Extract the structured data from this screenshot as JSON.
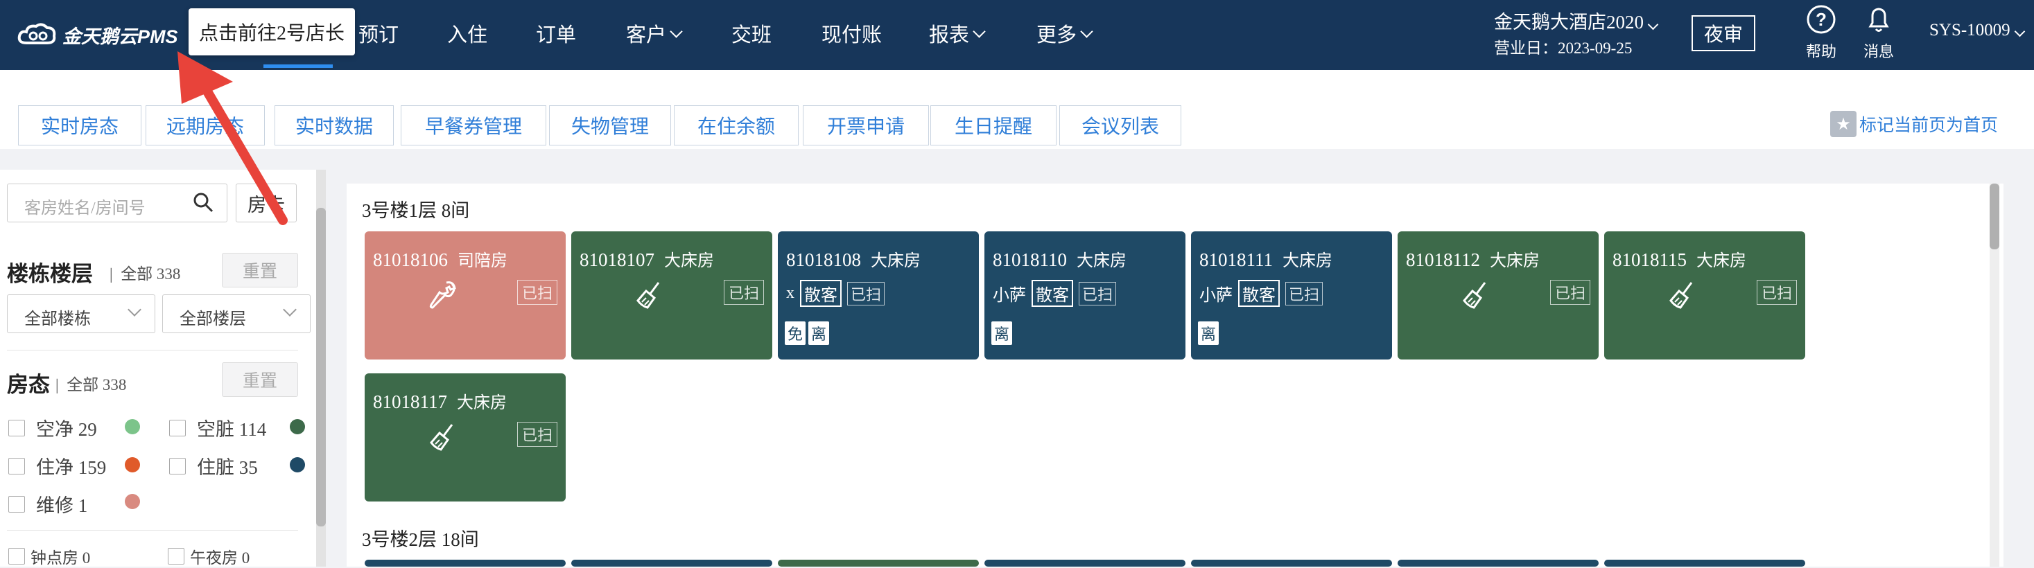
{
  "brand": {
    "name": "金天鹅云PMS"
  },
  "tooltip": "点击前往2号店长",
  "nav": [
    {
      "label": "预订",
      "dropdown": false
    },
    {
      "label": "入住",
      "dropdown": false
    },
    {
      "label": "订单",
      "dropdown": false
    },
    {
      "label": "客户",
      "dropdown": true
    },
    {
      "label": "交班",
      "dropdown": false
    },
    {
      "label": "现付账",
      "dropdown": false
    },
    {
      "label": "报表",
      "dropdown": true
    },
    {
      "label": "更多",
      "dropdown": true
    }
  ],
  "header": {
    "hotel": "金天鹅大酒店2020",
    "business_date": "营业日：2023-09-25",
    "night_audit": "夜审",
    "help": "帮助",
    "messages": "消息",
    "user": "SYS-10009"
  },
  "tabs": [
    "实时房态",
    "远期房态",
    "实时数据",
    "早餐券管理",
    "失物管理",
    "在住余额",
    "开票申请",
    "生日提醒",
    "会议列表"
  ],
  "mark_home": "标记当前页为首页",
  "sidebar": {
    "search_placeholder": "客房姓名/房间号",
    "room_card": "房卡",
    "building_title": "楼栋楼层",
    "building_count": "全部 338",
    "reset": "重置",
    "all_buildings": "全部楼栋",
    "all_floors": "全部楼层",
    "status_title": "房态",
    "status_count": "全部 338",
    "statuses": [
      {
        "label": "空净 29",
        "color": "#7cc48a"
      },
      {
        "label": "空脏 114",
        "color": "#3d6a4a"
      },
      {
        "label": "住净 159",
        "color": "#e05a2a"
      },
      {
        "label": "住脏 35",
        "color": "#1f4a66"
      },
      {
        "label": "维修 1",
        "color": "#d98a80"
      }
    ],
    "extra": [
      "钟点房 0",
      "午夜房 0"
    ]
  },
  "floors": [
    {
      "title": "3号楼1层 8间"
    },
    {
      "title": "3号楼2层 18间"
    }
  ],
  "rooms": [
    {
      "num": "81018106",
      "type": "司陪房",
      "tag": "已扫",
      "color": "#d4867c",
      "icon": "wrench-icon"
    },
    {
      "num": "81018107",
      "type": "大床房",
      "tag": "已扫",
      "color": "#3d6a4a",
      "icon": "broom-icon"
    },
    {
      "num": "81018108",
      "type": "大床房",
      "guest": "x",
      "badge": "散客",
      "tag": "已扫",
      "color": "#1f4a66",
      "stats": [
        "免",
        "离"
      ]
    },
    {
      "num": "81018110",
      "type": "大床房",
      "guest": "小萨",
      "badge": "散客",
      "tag": "已扫",
      "color": "#1f4a66",
      "stats": [
        "离"
      ]
    },
    {
      "num": "81018111",
      "type": "大床房",
      "guest": "小萨",
      "badge": "散客",
      "tag": "已扫",
      "color": "#1f4a66",
      "stats": [
        "离"
      ]
    },
    {
      "num": "81018112",
      "type": "大床房",
      "tag": "已扫",
      "color": "#3d6a4a",
      "icon": "broom-icon"
    },
    {
      "num": "81018115",
      "type": "大床房",
      "tag": "已扫",
      "color": "#3d6a4a",
      "icon": "broom-icon"
    },
    {
      "num": "81018117",
      "type": "大床房",
      "tag": "已扫",
      "color": "#3d6a4a",
      "icon": "broom-icon"
    }
  ],
  "colors": {
    "header_bg": "#17365a",
    "link": "#2f7ed8",
    "annotation_arrow": "#e8433a"
  }
}
